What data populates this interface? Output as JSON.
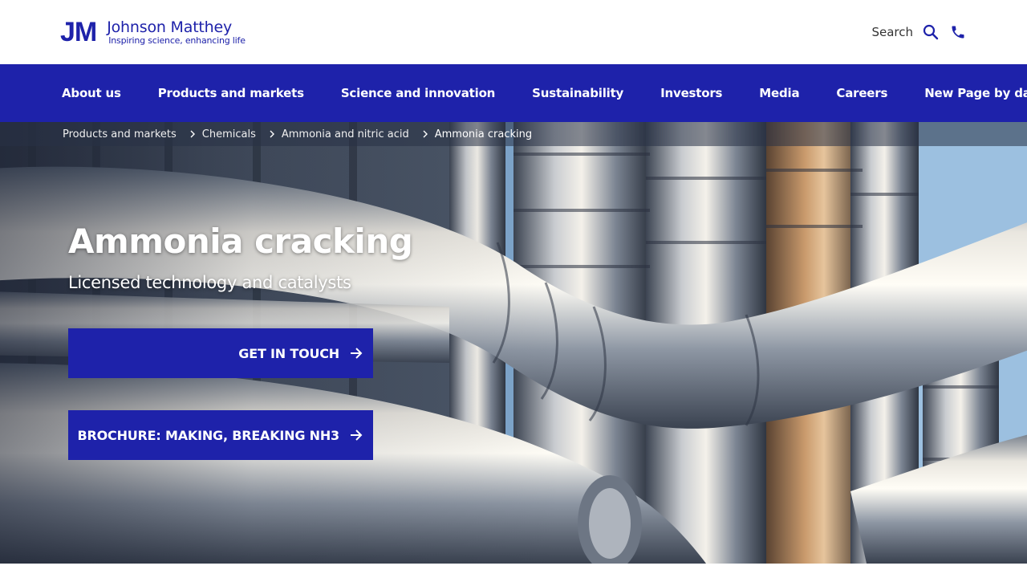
{
  "brand": {
    "mark": "JM",
    "name": "Johnson Matthey",
    "tagline": "Inspiring science, enhancing life",
    "color": "#1e22aa"
  },
  "utility": {
    "search_label": "Search",
    "search_icon": "search-icon",
    "phone_icon": "phone-icon"
  },
  "nav": {
    "items": [
      {
        "label": "About us"
      },
      {
        "label": "Products and markets"
      },
      {
        "label": "Science and innovation"
      },
      {
        "label": "Sustainability"
      },
      {
        "label": "Investors"
      },
      {
        "label": "Media"
      },
      {
        "label": "Careers"
      },
      {
        "label": "New Page by date"
      }
    ]
  },
  "breadcrumb": {
    "items": [
      {
        "label": "Products and markets"
      },
      {
        "label": "Chemicals"
      },
      {
        "label": "Ammonia and nitric acid"
      },
      {
        "label": "Ammonia cracking"
      }
    ]
  },
  "hero": {
    "title": "Ammonia cracking",
    "subtitle": "Licensed technology and catalysts",
    "buttons": [
      {
        "label": "GET IN TOUCH",
        "icon": "arrow-right-icon"
      },
      {
        "label": "BROCHURE: MAKING, BREAKING NH3",
        "icon": "arrow-right-icon"
      }
    ]
  }
}
